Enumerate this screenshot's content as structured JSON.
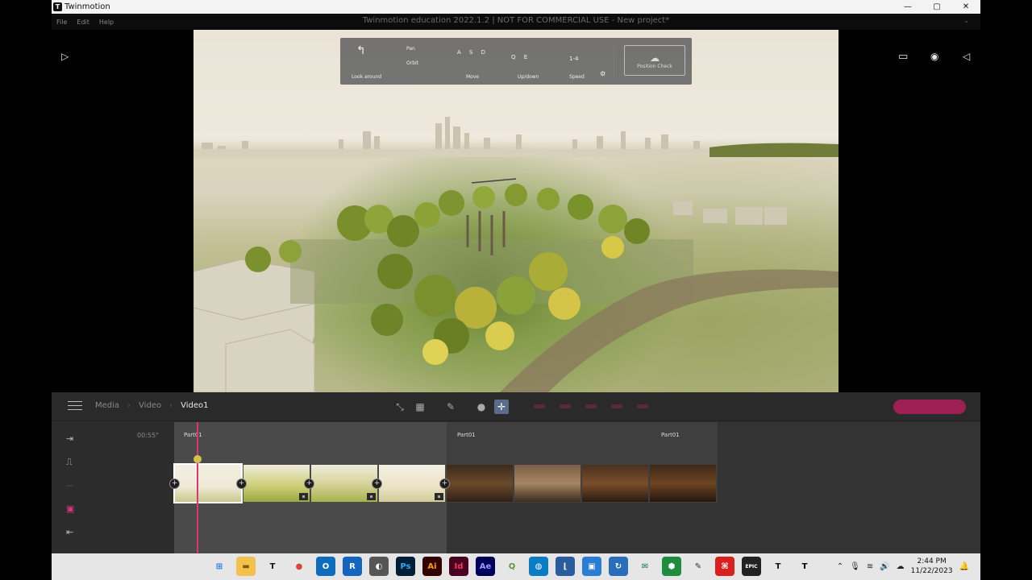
{
  "window": {
    "app_name": "Twinmotion",
    "controls": [
      "—",
      "▢",
      "✕"
    ]
  },
  "menu": {
    "items": [
      "File",
      "Edit",
      "Help"
    ],
    "title": "Twinmotion education 2022.1.2 | NOT FOR COMMERCIAL USE - New project*",
    "collapse": "⌄"
  },
  "nav_hud": {
    "groups": [
      "Look around",
      "Move",
      "Up/down",
      "Speed"
    ],
    "glyphs": {
      "pan": "Pan",
      "orbit": "Orbit"
    },
    "position_button": "Position Check"
  },
  "toolbar": {
    "breadcrumb": [
      "Media",
      "Video",
      "Video1"
    ]
  },
  "timeline": {
    "time": "00:55\"",
    "parts": [
      "Part01",
      "Part01",
      "Part01"
    ]
  },
  "taskbar": {
    "apps": [
      {
        "name": "windows-start",
        "glyph": "⊞",
        "bg": "#e6e6e6",
        "fg": "#1a73e8"
      },
      {
        "name": "file-explorer",
        "glyph": "▬",
        "bg": "#f2c14e",
        "fg": "#8a5a00"
      },
      {
        "name": "twinmotion",
        "glyph": "T",
        "bg": "#e6e6e6",
        "fg": "#111"
      },
      {
        "name": "chrome",
        "glyph": "●",
        "bg": "#e6e6e6",
        "fg": "#db4437"
      },
      {
        "name": "outlook",
        "glyph": "O",
        "bg": "#0f6cbd",
        "fg": "#fff"
      },
      {
        "name": "revit",
        "glyph": "R",
        "bg": "#1565c0",
        "fg": "#fff"
      },
      {
        "name": "browser",
        "glyph": "◐",
        "bg": "#555",
        "fg": "#fff"
      },
      {
        "name": "photoshop",
        "glyph": "Ps",
        "bg": "#001e36",
        "fg": "#31a8ff"
      },
      {
        "name": "illustrator",
        "glyph": "Ai",
        "bg": "#330000",
        "fg": "#ff9a00"
      },
      {
        "name": "indesign",
        "glyph": "Id",
        "bg": "#49021f",
        "fg": "#ff3366"
      },
      {
        "name": "after-effects",
        "glyph": "Ae",
        "bg": "#00005b",
        "fg": "#9999ff"
      },
      {
        "name": "qgis",
        "glyph": "Q",
        "bg": "#e6e6e6",
        "fg": "#589632"
      },
      {
        "name": "maps",
        "glyph": "◍",
        "bg": "#0a7cc4",
        "fg": "#fff"
      },
      {
        "name": "autocad",
        "glyph": "⌊",
        "bg": "#2a5d9e",
        "fg": "#fff"
      },
      {
        "name": "remote",
        "glyph": "▣",
        "bg": "#2b7cd3",
        "fg": "#fff"
      },
      {
        "name": "sync",
        "glyph": "↻",
        "bg": "#2a6ebb",
        "fg": "#fff"
      },
      {
        "name": "mail",
        "glyph": "✉",
        "bg": "#e6e6e6",
        "fg": "#0c7a3e"
      },
      {
        "name": "sheets",
        "glyph": "⬢",
        "bg": "#1e8e3e",
        "fg": "#fff"
      },
      {
        "name": "notes",
        "glyph": "✎",
        "bg": "#e6e6e6",
        "fg": "#333"
      },
      {
        "name": "acrobat",
        "glyph": "⌘",
        "bg": "#d9201f",
        "fg": "#fff"
      },
      {
        "name": "epic",
        "glyph": "EPIC",
        "bg": "#222",
        "fg": "#fff"
      },
      {
        "name": "twinmotion-2",
        "glyph": "T",
        "bg": "#e6e6e6",
        "fg": "#111"
      },
      {
        "name": "typora",
        "glyph": "T",
        "bg": "#e6e6e6",
        "fg": "#000"
      }
    ],
    "clock": {
      "time": "2:44 PM",
      "date": "11/22/2023"
    }
  },
  "colors": {
    "accent": "#d8357a",
    "panel": "#2c2c2c",
    "active": "#5a6b8c"
  }
}
